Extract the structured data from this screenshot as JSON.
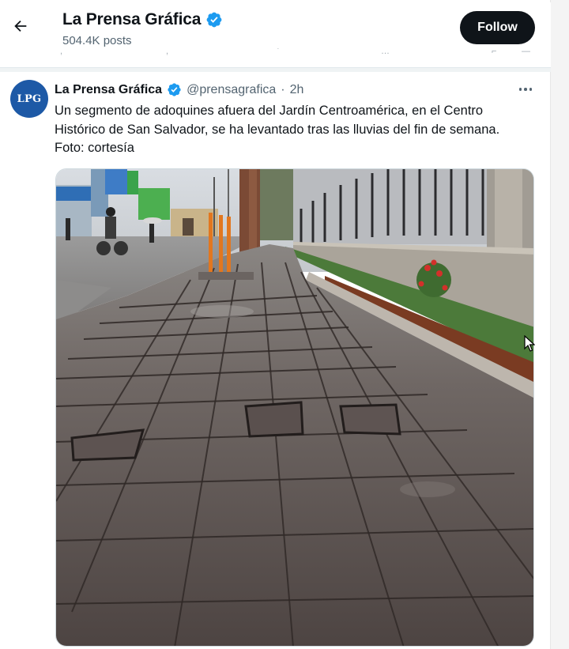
{
  "profile_header": {
    "title": "La Prensa Gráfica",
    "posts_count": "504.4K posts",
    "follow_label": "Follow"
  },
  "tweet": {
    "avatar_text": "LPG",
    "author_name": "La Prensa Gráfica",
    "handle": "@prensagrafica",
    "separator": "·",
    "time": "2h",
    "text": "Un segmento de adoquines afuera del Jardín Centroamérica, en el Centro Histórico de San Salvador, se ha levantado tras las lluvias del fin de semana. Foto: cortesía",
    "media": {
      "kind": "photo",
      "subject": "wet brick-paved sidewalk with raised pavers beside a fenced garden"
    }
  },
  "icons": {
    "back": "arrow-left-icon",
    "verified": "verified-badge-icon",
    "more": "more-horizontal-icon",
    "cursor": "mouse-pointer-icon"
  },
  "colors": {
    "brand_blue": "#1d9bf0",
    "avatar_blue": "#1d59a6",
    "text_primary": "#0f1419",
    "text_secondary": "#536471",
    "follow_button": "#0f1419"
  }
}
